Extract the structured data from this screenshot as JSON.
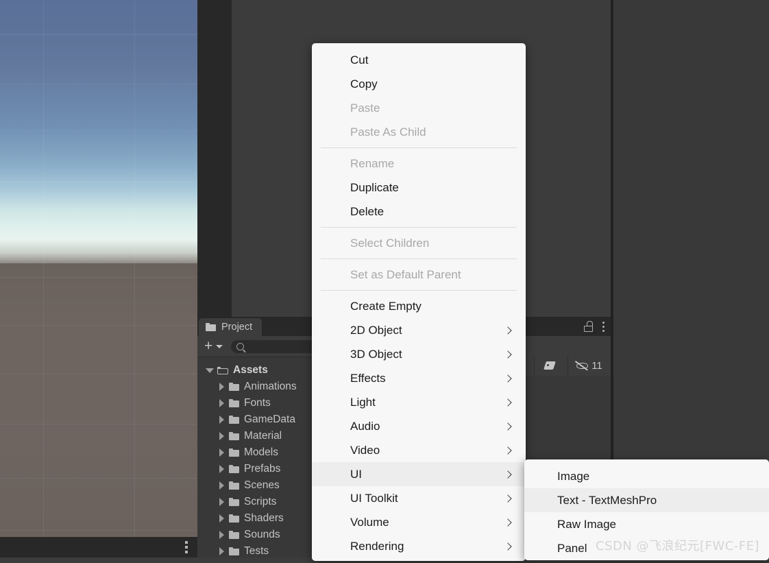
{
  "scene": {
    "name": "scene-view",
    "sky_top_color": "#5b7099",
    "sky_horizon_color": "#e9f3ef",
    "ground_color": "#6e6560"
  },
  "project_panel": {
    "tab_label": "Project",
    "tab_icon": "folder-icon",
    "lock_icon": "lock-open-icon",
    "menu_icon": "kebab-menu-icon",
    "add_label": "+",
    "search_value": "",
    "search_placeholder": "",
    "tools": [
      {
        "icon": "3d-shapes-icon",
        "label": ""
      },
      {
        "icon": "tag-icon",
        "label": ""
      },
      {
        "icon": "eye-hidden-icon",
        "label": "11"
      }
    ],
    "tree": [
      {
        "label": "Assets",
        "depth": 0,
        "expanded": true,
        "folder": "folder-open-icon"
      },
      {
        "label": "Animations",
        "depth": 1,
        "expanded": false,
        "folder": "folder-icon"
      },
      {
        "label": "Fonts",
        "depth": 1,
        "expanded": false,
        "folder": "folder-icon"
      },
      {
        "label": "GameData",
        "depth": 1,
        "expanded": false,
        "folder": "folder-icon"
      },
      {
        "label": "Material",
        "depth": 1,
        "expanded": false,
        "folder": "folder-icon"
      },
      {
        "label": "Models",
        "depth": 1,
        "expanded": false,
        "folder": "folder-icon"
      },
      {
        "label": "Prefabs",
        "depth": 1,
        "expanded": false,
        "folder": "folder-icon"
      },
      {
        "label": "Scenes",
        "depth": 1,
        "expanded": false,
        "folder": "folder-icon"
      },
      {
        "label": "Scripts",
        "depth": 1,
        "expanded": false,
        "folder": "folder-icon"
      },
      {
        "label": "Shaders",
        "depth": 1,
        "expanded": false,
        "folder": "folder-icon"
      },
      {
        "label": "Sounds",
        "depth": 1,
        "expanded": false,
        "folder": "folder-icon"
      },
      {
        "label": "Tests",
        "depth": 1,
        "expanded": false,
        "folder": "folder-icon"
      }
    ]
  },
  "context_menu": {
    "items": [
      {
        "label": "Cut",
        "disabled": false,
        "submenu": false,
        "highlight": false
      },
      {
        "label": "Copy",
        "disabled": false,
        "submenu": false,
        "highlight": false
      },
      {
        "label": "Paste",
        "disabled": true,
        "submenu": false,
        "highlight": false
      },
      {
        "label": "Paste As Child",
        "disabled": true,
        "submenu": false,
        "highlight": false
      },
      {
        "separator": true
      },
      {
        "label": "Rename",
        "disabled": true,
        "submenu": false,
        "highlight": false
      },
      {
        "label": "Duplicate",
        "disabled": false,
        "submenu": false,
        "highlight": false
      },
      {
        "label": "Delete",
        "disabled": false,
        "submenu": false,
        "highlight": false
      },
      {
        "separator": true
      },
      {
        "label": "Select Children",
        "disabled": true,
        "submenu": false,
        "highlight": false
      },
      {
        "separator": true
      },
      {
        "label": "Set as Default Parent",
        "disabled": true,
        "submenu": false,
        "highlight": false
      },
      {
        "separator": true
      },
      {
        "label": "Create Empty",
        "disabled": false,
        "submenu": false,
        "highlight": false
      },
      {
        "label": "2D Object",
        "disabled": false,
        "submenu": true,
        "highlight": false
      },
      {
        "label": "3D Object",
        "disabled": false,
        "submenu": true,
        "highlight": false
      },
      {
        "label": "Effects",
        "disabled": false,
        "submenu": true,
        "highlight": false
      },
      {
        "label": "Light",
        "disabled": false,
        "submenu": true,
        "highlight": false
      },
      {
        "label": "Audio",
        "disabled": false,
        "submenu": true,
        "highlight": false
      },
      {
        "label": "Video",
        "disabled": false,
        "submenu": true,
        "highlight": false
      },
      {
        "label": "UI",
        "disabled": false,
        "submenu": true,
        "highlight": true
      },
      {
        "label": "UI Toolkit",
        "disabled": false,
        "submenu": true,
        "highlight": false
      },
      {
        "label": "Volume",
        "disabled": false,
        "submenu": true,
        "highlight": false
      },
      {
        "label": "Rendering",
        "disabled": false,
        "submenu": true,
        "highlight": false
      }
    ]
  },
  "sub_menu": {
    "parent": "UI",
    "items": [
      {
        "label": "Image",
        "disabled": false,
        "submenu": false,
        "highlight": false
      },
      {
        "label": "Text - TextMeshPro",
        "disabled": false,
        "submenu": false,
        "highlight": true
      },
      {
        "label": "Raw Image",
        "disabled": false,
        "submenu": false,
        "highlight": false
      },
      {
        "label": "Panel",
        "disabled": false,
        "submenu": false,
        "highlight": false
      }
    ]
  },
  "watermark": {
    "text": "CSDN @飞浪纪元[FWC-FE]"
  }
}
